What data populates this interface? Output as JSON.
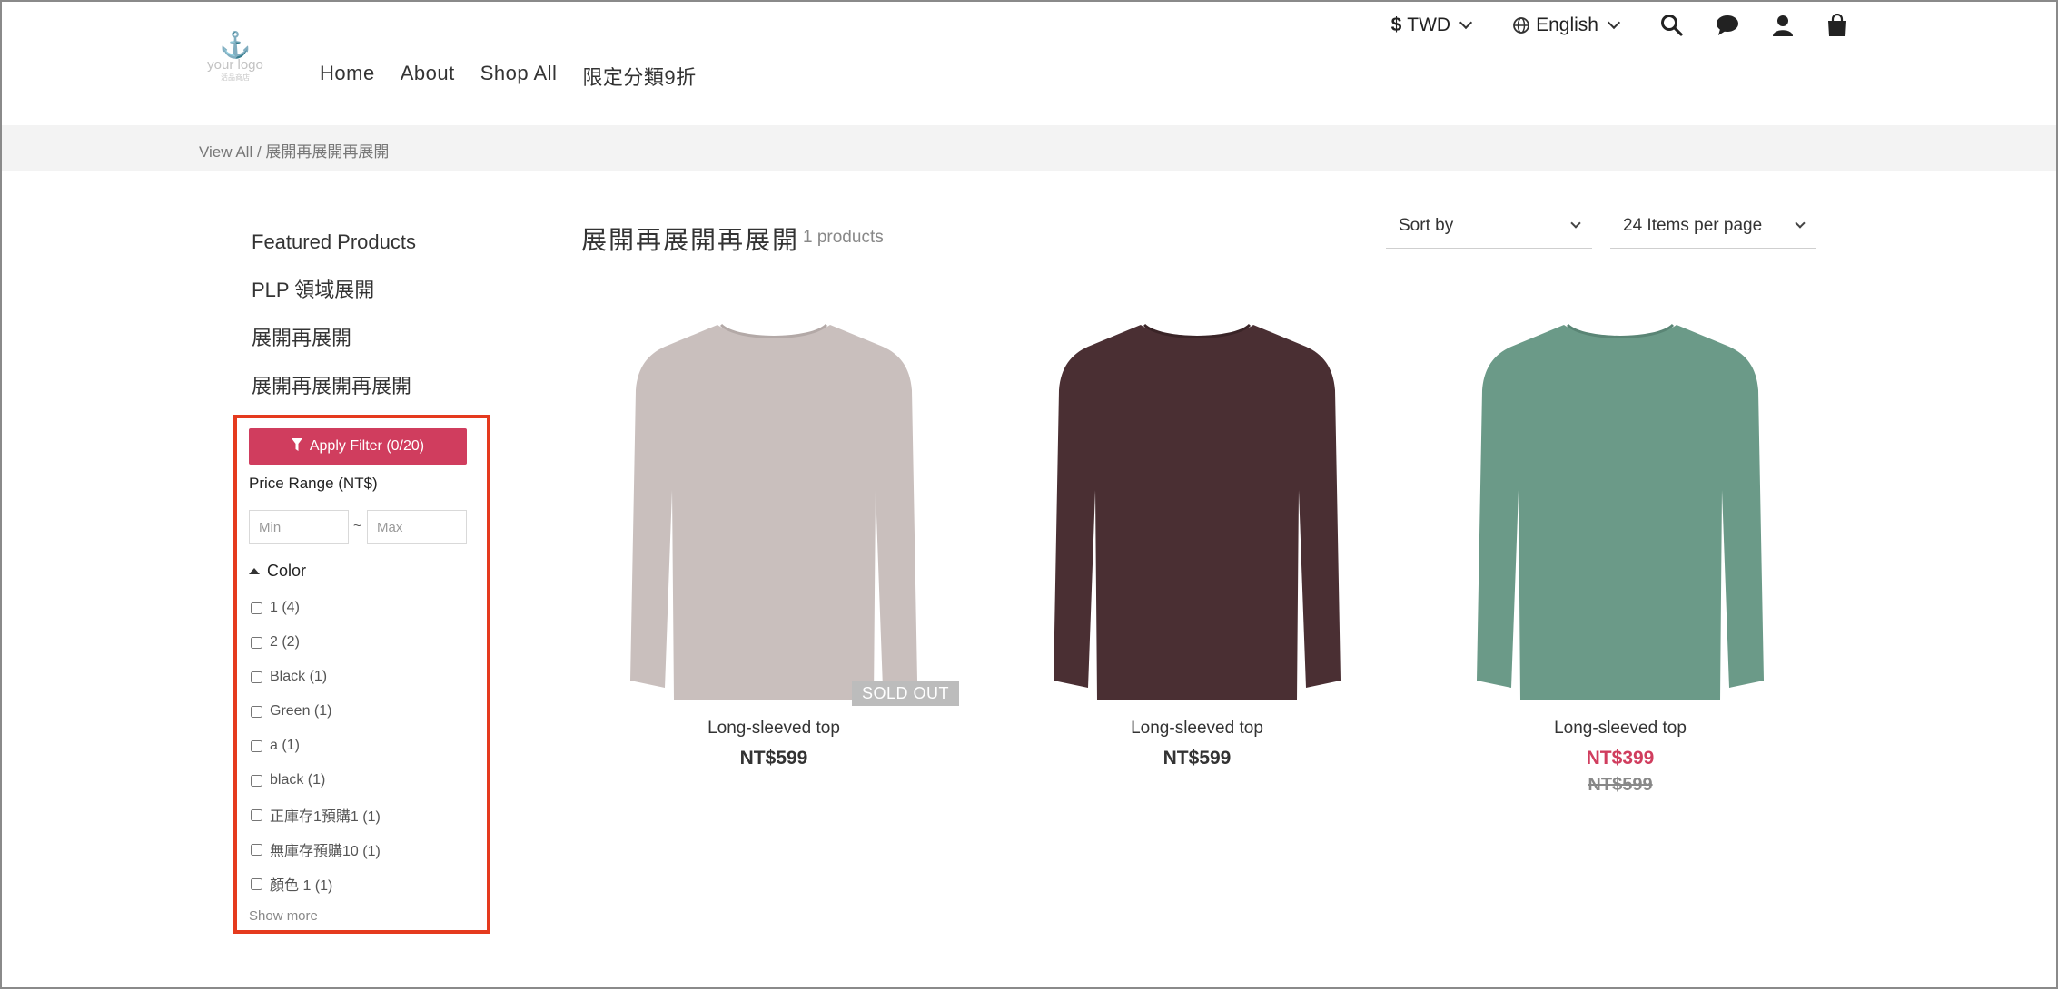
{
  "header": {
    "currency": "TWD",
    "currency_symbol": "$",
    "language": "English",
    "icons": [
      "search-icon",
      "chat-icon",
      "user-icon",
      "cart-icon"
    ]
  },
  "logo": {
    "line1": "your logo",
    "line2": "活品商店"
  },
  "nav": [
    "Home",
    "About",
    "Shop All",
    "限定分類9折"
  ],
  "breadcrumb": "View All / 展開再展開再展開",
  "sidebar": {
    "categories": [
      "Featured Products",
      "PLP 領域展開",
      "展開再展開",
      "展開再展開再展開"
    ],
    "filter": {
      "apply_label": "Apply Filter (0/20)",
      "price_label": "Price Range (NT$)",
      "min_placeholder": "Min",
      "max_placeholder": "Max",
      "separator": "~",
      "color_label": "Color",
      "options": [
        "1 (4)",
        "2 (2)",
        "Black (1)",
        "Green (1)",
        "a (1)",
        "black (1)",
        "正庫存1預購1 (1)",
        "無庫存預購10 (1)",
        "顏色 1 (1)"
      ],
      "show_more": "Show more"
    },
    "accent_color": "#d03d5e",
    "highlight_color": "#e53a1e"
  },
  "main": {
    "title": "展開再展開再展開",
    "count": "1 products",
    "sort_label": "Sort by",
    "per_page_label": "24 Items per page",
    "products": [
      {
        "name": "Long-sleeved top",
        "price": "NT$599",
        "badge": "SOLD OUT",
        "color": "#c9bfbd"
      },
      {
        "name": "Long-sleeved top",
        "price": "NT$599",
        "color": "#4a2f33"
      },
      {
        "name": "Long-sleeved top",
        "price": "NT$399",
        "old_price": "NT$599",
        "color": "#6b9a88"
      }
    ]
  }
}
